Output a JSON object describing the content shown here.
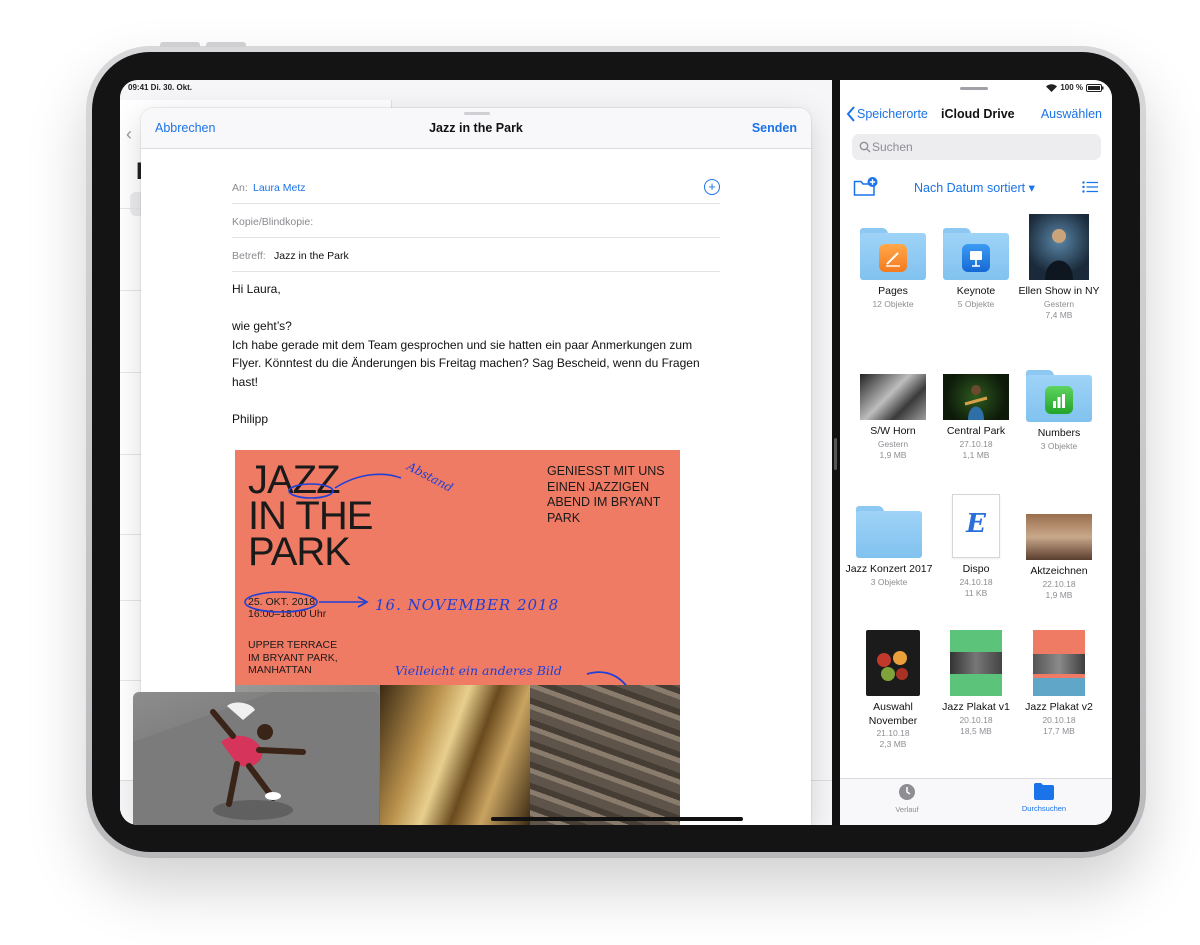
{
  "status": {
    "time_date": "09:41  Di. 30. Okt.",
    "battery": "100 %"
  },
  "compose": {
    "cancel_label": "Abbrechen",
    "title": "Jazz in the Park",
    "send_label": "Senden",
    "to_label": "An:",
    "to_value": "Laura Metz",
    "cc_label": "Kopie/Blindkopie:",
    "subject_label": "Betreff:",
    "subject_value": "Jazz in the Park",
    "body": "Hi Laura,\n\nwie geht’s?\nIch habe gerade mit dem Team gesprochen und sie hatten ein paar Anmerkungen zum Flyer. Könntest du die Änderungen bis Freitag machen? Sag Bescheid, wenn du Fragen hast!\n\nPhilipp"
  },
  "poster": {
    "title_line1": "JAZZ",
    "title_line2": "IN THE",
    "title_line3": "PARK",
    "tagline": "GENIESST MIT UNS EINEN JAZZIGEN ABEND IM BRYANT PARK",
    "date": "25. OKT. 2018",
    "time": "16:00–18:00 Uhr",
    "location_l1": "UPPER TERRACE",
    "location_l2": "IM BRYANT PARK,",
    "location_l3": "MANHATTAN",
    "note_abstand": "Abstand",
    "note_date": "16. NOVEMBER 2018",
    "note_image": "Vielleicht ein anderes Bild",
    "color": "#ef7b65",
    "ink_color": "#1f3fd6"
  },
  "files": {
    "back_label": "Speicherorte",
    "title": "iCloud Drive",
    "select_label": "Auswählen",
    "search_placeholder": "Suchen",
    "sort_label": "Nach Datum sortiert",
    "items": [
      {
        "name": "Pages",
        "meta1": "12 Objekte",
        "meta2": "",
        "meta3": ""
      },
      {
        "name": "Keynote",
        "meta1": "5 Objekte",
        "meta2": "",
        "meta3": ""
      },
      {
        "name": "Ellen Show in NY",
        "meta1": "Gestern",
        "meta2": "7,4 MB",
        "meta3": ""
      },
      {
        "name": "S/W Horn",
        "meta1": "Gestern",
        "meta2": "1,9 MB",
        "meta3": ""
      },
      {
        "name": "Central Park",
        "meta1": "27.10.18",
        "meta2": "1,1 MB",
        "meta3": ""
      },
      {
        "name": "Numbers",
        "meta1": "3 Objekte",
        "meta2": "",
        "meta3": ""
      },
      {
        "name": "Jazz Konzert 2017",
        "meta1": "3 Objekte",
        "meta2": "",
        "meta3": ""
      },
      {
        "name": "Dispo",
        "meta1": "24.10.18",
        "meta2": "11 KB",
        "meta3": ""
      },
      {
        "name": "Aktzeichnen",
        "meta1": "22.10.18",
        "meta2": "1,9 MB",
        "meta3": ""
      },
      {
        "name": "Auswahl November",
        "meta1": "21.10.18",
        "meta2": "2,3 MB",
        "meta3": ""
      },
      {
        "name": "Jazz Plakat v1",
        "meta1": "20.10.18",
        "meta2": "18,5 MB",
        "meta3": ""
      },
      {
        "name": "Jazz Plakat v2",
        "meta1": "20.10.18",
        "meta2": "17,7 MB",
        "meta3": ""
      }
    ],
    "tabs": [
      {
        "label": "Verlauf",
        "icon": "clock-icon",
        "active": false
      },
      {
        "label": "Durchsuchen",
        "icon": "folder-icon",
        "active": true
      }
    ],
    "accent": "#1a73e8"
  }
}
